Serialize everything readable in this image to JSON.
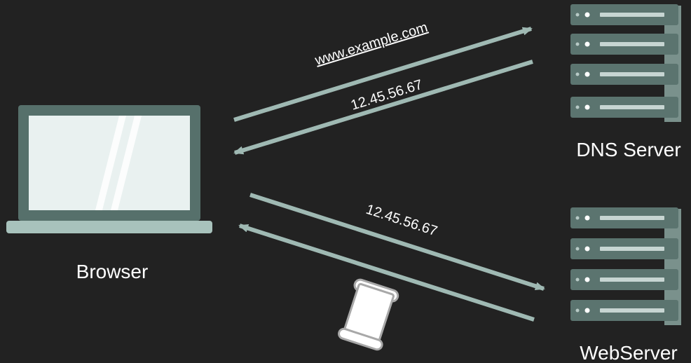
{
  "labels": {
    "browser": "Browser",
    "dns_server": "DNS Server",
    "web_server": "WebServer"
  },
  "messages": {
    "dns_query": "www.example.com",
    "dns_response": "12.45.56.67",
    "web_request": "12.45.56.67"
  },
  "colors": {
    "background": "#222222",
    "arrow": "#9fb9b3",
    "device_dark": "#56706b",
    "device_light": "#a8c2bc",
    "screen": "#e9f1f0",
    "server_unit": "#5b746f",
    "server_shadow": "#7a918c",
    "text": "#ffffff",
    "document": "#ffffff",
    "document_outline": "#a8a8a8"
  },
  "icons": {
    "browser": "laptop-icon",
    "dns_server": "server-rack-icon",
    "web_server": "server-rack-icon",
    "response": "document-scroll-icon"
  }
}
